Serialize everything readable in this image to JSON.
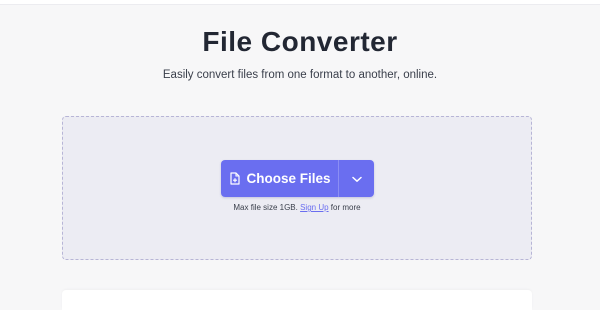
{
  "header": {
    "title": "File Converter",
    "subtitle": "Easily convert files from one format to another, online."
  },
  "upload": {
    "choose_label": "Choose Files",
    "choose_icon": "file-add-icon",
    "dropdown_icon": "chevron-down-icon",
    "limit_prefix": "Max file size 1GB.",
    "signup_link": "Sign Up",
    "limit_suffix": "for more"
  },
  "colors": {
    "accent": "#6a6ef0",
    "dropzone_bg": "#ececf3",
    "dropzone_border": "#b7b5d6",
    "page_bg": "#f7f7f8"
  }
}
